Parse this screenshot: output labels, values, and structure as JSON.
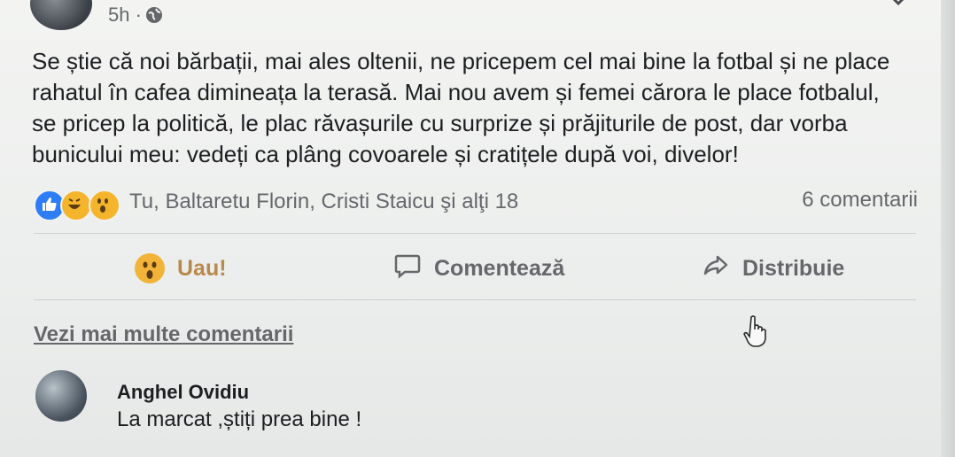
{
  "post": {
    "time": "5h ·",
    "text_lines": [
      "Se știe că noi bărbații, mai ales oltenii, ne pricepem cel mai bine la fotbal și ne place",
      "rahatul în cafea dimineața la terasă. Mai nou avem și femei cărora le place fotbalul,",
      "se pricep la politică, le plac răvașurile cu surprize și prăjiturile de post,  dar vorba",
      "bunicului meu: vedeți ca plâng covoarele și cratițele după voi, divelor!"
    ]
  },
  "reactions": {
    "names": "Tu, Baltaretu Florin, Cristi Staicu şi alţi 18",
    "comments": "6 comentarii",
    "icons": [
      "like-icon",
      "haha-icon",
      "wow-icon"
    ]
  },
  "actions": {
    "wow": "Uau!",
    "comment": "Comentează",
    "share": "Distribuie"
  },
  "comments": {
    "more": "Vezi mai multe comentarii",
    "items": [
      {
        "author": "Anghel Ovidiu",
        "text": "La marcat ,știți prea bine !"
      }
    ]
  },
  "colors": {
    "like_blue": "#2d7df6",
    "reaction_yellow": "#f4b52c",
    "secondary_text": "#65676b"
  }
}
